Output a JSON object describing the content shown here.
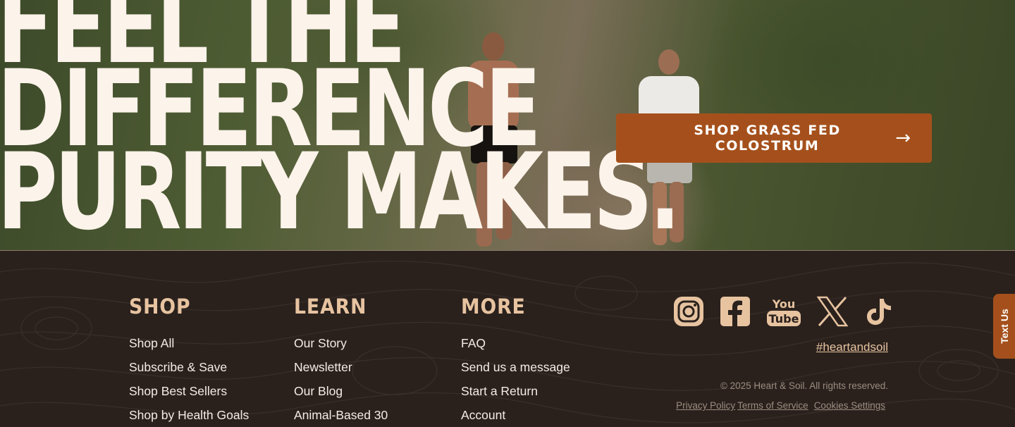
{
  "hero": {
    "headline_lines": [
      "FEEL THE",
      "DIFFERENCE",
      "PURITY MAKES."
    ],
    "cta_label": "SHOP GRASS FED COLOSTRUM",
    "cta_arrow": "→"
  },
  "footer": {
    "columns": [
      {
        "title": "SHOP",
        "links": [
          "Shop All",
          "Subscribe & Save",
          "Shop Best Sellers",
          "Shop by Health Goals"
        ]
      },
      {
        "title": "LEARN",
        "links": [
          "Our Story",
          "Newsletter",
          "Our Blog",
          "Animal-Based 30"
        ]
      },
      {
        "title": "MORE",
        "links": [
          "FAQ",
          "Send us a message",
          "Start a Return",
          "Account"
        ]
      }
    ],
    "social_icons": [
      "instagram-icon",
      "facebook-icon",
      "youtube-icon",
      "x-icon",
      "tiktok-icon"
    ],
    "youtube_text": [
      "You",
      "Tube"
    ],
    "hashtag": "#heartandsoil",
    "copyright": "© 2025 Heart & Soil. All rights reserved.",
    "legal_links": [
      "Privacy Policy",
      "Terms of Service",
      "Cookies Settings"
    ]
  },
  "textus_label": "Text Us",
  "colors": {
    "accent": "#a5501c",
    "footer_bg": "#2a211d",
    "heading_tan": "#e7c3a0",
    "headline_cream": "#fcf3ea"
  }
}
